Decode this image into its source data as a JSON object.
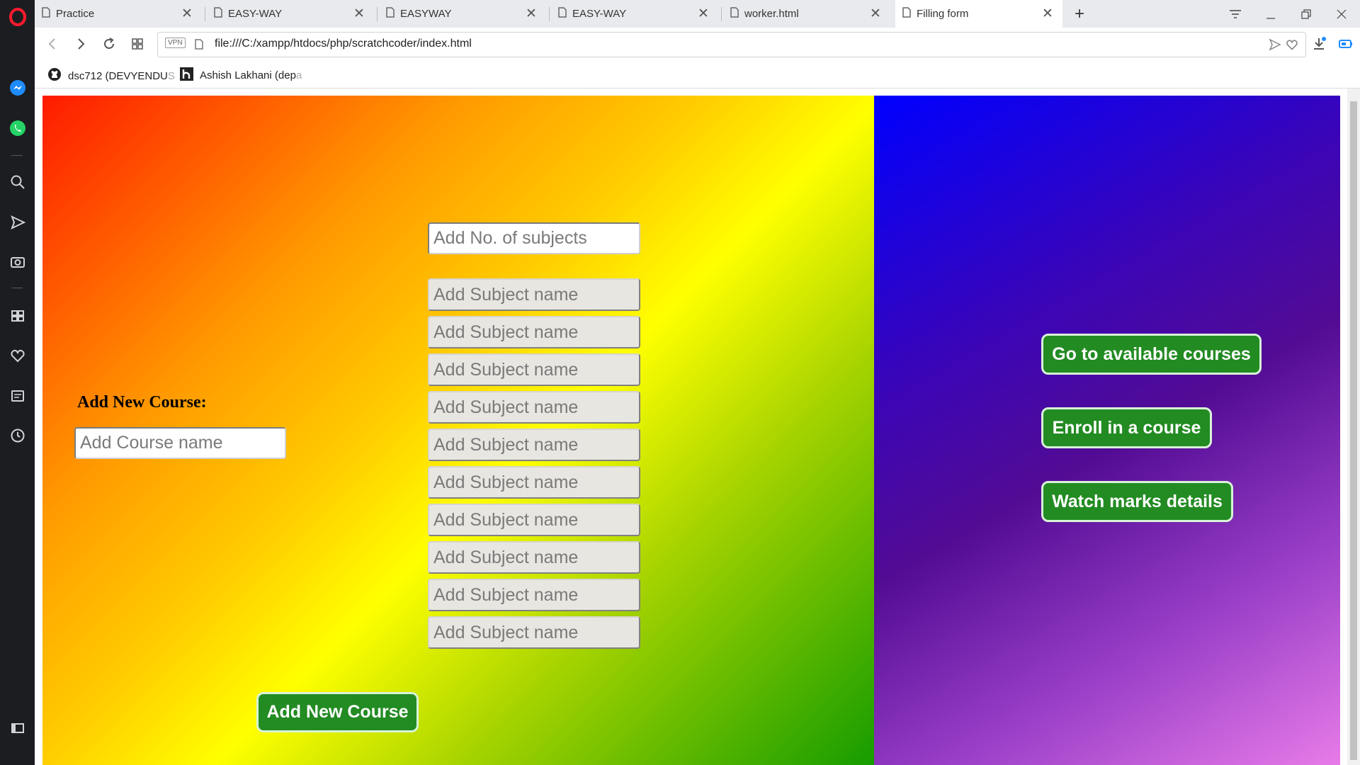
{
  "browser": {
    "tabs": [
      {
        "title": "Practice",
        "active": false
      },
      {
        "title": "EASY-WAY",
        "active": false
      },
      {
        "title": "EASYWAY",
        "active": false
      },
      {
        "title": "EASY-WAY",
        "active": false
      },
      {
        "title": "worker.html",
        "active": false
      },
      {
        "title": "Filling form",
        "active": true
      }
    ],
    "url": "file:///C:/xampp/htdocs/php/scratchcoder/index.html",
    "vpn_label": "VPN",
    "bookmarks": [
      {
        "label": "dsc712 (DEVYENDU",
        "fade": " S",
        "icon": "github-icon"
      },
      {
        "label": "Ashish Lakhani (dep",
        "fade": "a",
        "icon": "hashnode-icon"
      }
    ]
  },
  "form": {
    "course_label": "Add New Course:",
    "course_name_placeholder": "Add Course name",
    "subjects_count_placeholder": "Add No. of subjects",
    "subject_placeholder": "Add Subject name",
    "subject_field_count": 10,
    "add_course_button": "Add New Course"
  },
  "actions": {
    "available_courses": "Go to available courses",
    "enroll": "Enroll in a course",
    "marks": "Watch marks details"
  },
  "colors": {
    "button_green": "#228b22",
    "left_gradient": [
      "#ff1a00",
      "#ffff00",
      "#169c00"
    ],
    "right_gradient": [
      "#0000ff",
      "#520b94",
      "#e77be8"
    ]
  }
}
